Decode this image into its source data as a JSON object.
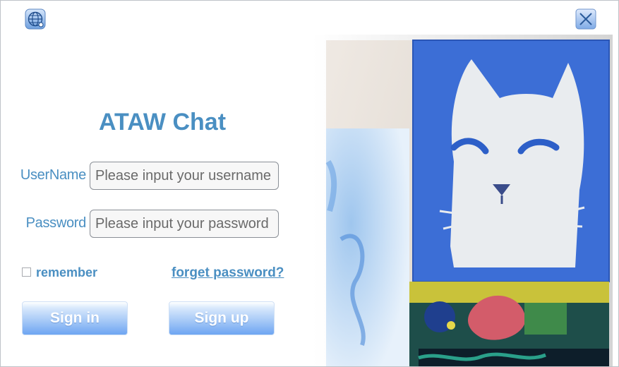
{
  "app": {
    "title": "ATAW Chat"
  },
  "form": {
    "username_label": "UserName",
    "username_placeholder": "Please input your username",
    "password_label": "Password",
    "password_placeholder": "Please input your password",
    "remember_label": "remember",
    "forget_label": "forget password?"
  },
  "buttons": {
    "sign_in": "Sign in",
    "sign_up": "Sign up"
  },
  "icons": {
    "language": "globe-icon",
    "close": "close-icon"
  },
  "colors": {
    "accent": "#4a8fc2",
    "button_top": "#ffffff",
    "button_bottom": "#6ea5f2"
  }
}
